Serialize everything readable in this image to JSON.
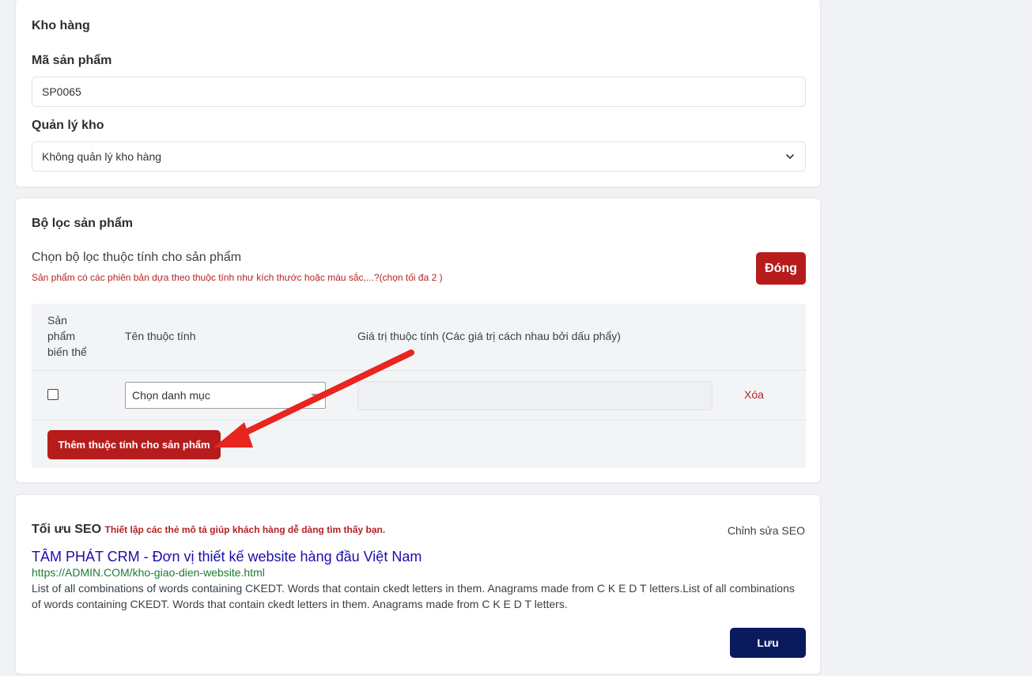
{
  "warehouse": {
    "title": "Kho hàng",
    "sku_label": "Mã sản phẩm",
    "sku_value": "SP0065",
    "manage_label": "Quản lý kho",
    "manage_value": "Không quản lý kho hàng"
  },
  "filter": {
    "title": "Bộ lọc sản phẩm",
    "subtitle": "Chọn bộ lọc thuộc tính cho sản phẩm",
    "hint": "Sản phẩm có các phiên bản dựa theo thuộc tính như kích thước hoặc màu sắc,...?(chọn tối đa 2 )",
    "close_button": "Đóng",
    "columns": {
      "variant_line1": "Sản",
      "variant_line2": "phẩm",
      "variant_line3": "biến thể",
      "attr_name": "Tên thuộc tính",
      "attr_value": "Giá trị thuộc tính (Các giá trị cách nhau bởi dấu phẩy)"
    },
    "row": {
      "select_value": "Chọn danh mục",
      "value_input": "",
      "delete_link": "Xóa"
    },
    "add_button": "Thêm thuộc tính cho sản phẩm"
  },
  "seo": {
    "title": "Tối ưu SEO",
    "hint": "Thiết lập các thẻ mô tả giúp khách hàng dễ dàng tìm thấy bạn.",
    "edit_link": "Chỉnh sửa SEO",
    "preview_title": "TÂM PHÁT CRM - Đơn vị thiết kế website hàng đầu Việt Nam",
    "preview_url": "https://ADMIN.COM/kho-giao-dien-website.html",
    "preview_desc": "List of all combinations of words containing CKEDT. Words that contain ckedt letters in them. Anagrams made from C K E D T letters.List of all combinations of words containing CKEDT. Words that contain ckedt letters in them. Anagrams made from C K E D T letters.",
    "save_button": "Lưu"
  },
  "colors": {
    "accent_red": "#b71c1c",
    "navy": "#0b1a5c",
    "link_blue": "#1a0dab",
    "url_green": "#1e7b34",
    "annotation_red": "#e8251f"
  },
  "icons": {
    "manage_chevron": "chevron-down-icon",
    "select_caret": "caret-down-icon",
    "annotation": "arrow-annotation-icon"
  }
}
